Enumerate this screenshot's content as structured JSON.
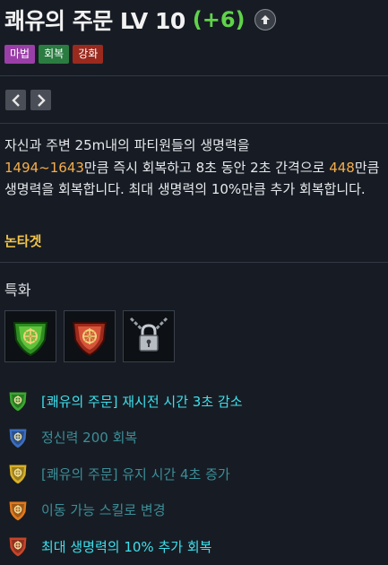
{
  "skill": {
    "title": "쾌유의 주문 LV 10",
    "plus": "(+6)",
    "upgrade_icon": "arrow-up-circle-icon"
  },
  "tags": [
    "마법",
    "회복",
    "강화"
  ],
  "colors": {
    "tag_magic": "#9b3fa8",
    "tag_heal": "#2a7c41",
    "tag_enhance": "#9a2a1e",
    "plus_green": "#5fd34a",
    "number_orange": "#f6ad4a",
    "target_yellow": "#f3c54a",
    "highlight_cyan": "#3fe0ec",
    "dim_teal": "#3c8e98"
  },
  "description": {
    "p1": "자신과 주변 25m내의 파티원들의 생명력을",
    "n1": "1494~1643",
    "p2": "만큼 즉시 회복하고 8초 동안 2초 간격으로 ",
    "n2": "448",
    "p3": "만큼 생명력을 회복합니다. 최대 생명력의 10%만큼 추가 회복합니다."
  },
  "target_type": "논타겟",
  "specialization": {
    "title": "특화",
    "icons": [
      "green-shield-emblem-icon",
      "red-shield-emblem-icon",
      "chained-padlock-icon"
    ]
  },
  "tripods": [
    {
      "text": "[쾌유의 주문] 재시전 시간 3초 감소",
      "icon": "green-tripod-shield-icon",
      "active": true
    },
    {
      "text": "정신력 200 회복",
      "icon": "blue-tripod-shield-icon",
      "active": false
    },
    {
      "text": "[쾌유의 주문] 유지 시간 4초 증가",
      "icon": "yellow-tripod-shield-icon",
      "active": false
    },
    {
      "text": "이동 가능 스킬로 변경",
      "icon": "orange-tripod-shield-icon",
      "active": false
    },
    {
      "text": "최대 생명력의 10% 추가 회복",
      "icon": "red-tripod-shield-icon",
      "active": true
    }
  ]
}
